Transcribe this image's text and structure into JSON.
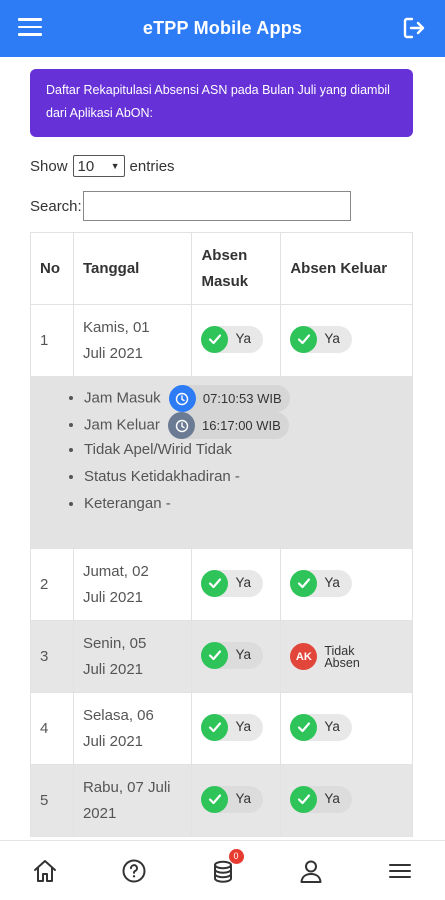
{
  "app": {
    "title": "eTPP Mobile Apps"
  },
  "alert": {
    "text": "Daftar Rekapitulasi Absensi ASN pada Bulan Juli yang diambil dari Aplikasi AbON:"
  },
  "table_controls": {
    "show_label": "Show",
    "entries_value": "10",
    "entries_label": "entries",
    "search_label": "Search:",
    "search_value": ""
  },
  "table": {
    "headers": {
      "no": "No",
      "tanggal": "Tanggal",
      "absen_masuk": "Absen Masuk",
      "absen_keluar": "Absen Keluar"
    },
    "rows": [
      {
        "no": "1",
        "date_line1": "Kamis, 01",
        "date_line2": "Juli 2021",
        "masuk": "Ya",
        "keluar": "Ya"
      },
      {
        "no": "2",
        "date_line1": "Jumat, 02",
        "date_line2": "Juli 2021",
        "masuk": "Ya",
        "keluar": "Ya"
      },
      {
        "no": "3",
        "date_line1": "Senin, 05",
        "date_line2": "Juli 2021",
        "masuk": "Ya",
        "keluar_line1": "Tidak",
        "keluar_line2": "Absen",
        "keluar_badge": "AK"
      },
      {
        "no": "4",
        "date_line1": "Selasa, 06",
        "date_line2": "Juli 2021",
        "masuk": "Ya",
        "keluar": "Ya"
      },
      {
        "no": "5",
        "date_line1": "Rabu, 07 Juli",
        "date_line2": "2021",
        "masuk": "Ya",
        "keluar": "Ya"
      }
    ],
    "detail": {
      "jam_masuk_label": "Jam Masuk",
      "jam_masuk_value": "07:10:53 WIB",
      "jam_keluar_label": "Jam Keluar",
      "jam_keluar_value": "16:17:00 WIB",
      "apel": "Tidak Apel/Wirid Tidak",
      "status": "Status Ketidakhadiran -",
      "keterangan": "Keterangan -"
    }
  },
  "bottom_nav": {
    "badge_count": "0"
  },
  "colors": {
    "primary": "#2d7cf6",
    "alert_bg": "#6631d6",
    "success": "#2fc45a",
    "danger": "#e2463a",
    "clock_masuk": "#2d7cf6",
    "clock_keluar": "#6b7b93"
  }
}
